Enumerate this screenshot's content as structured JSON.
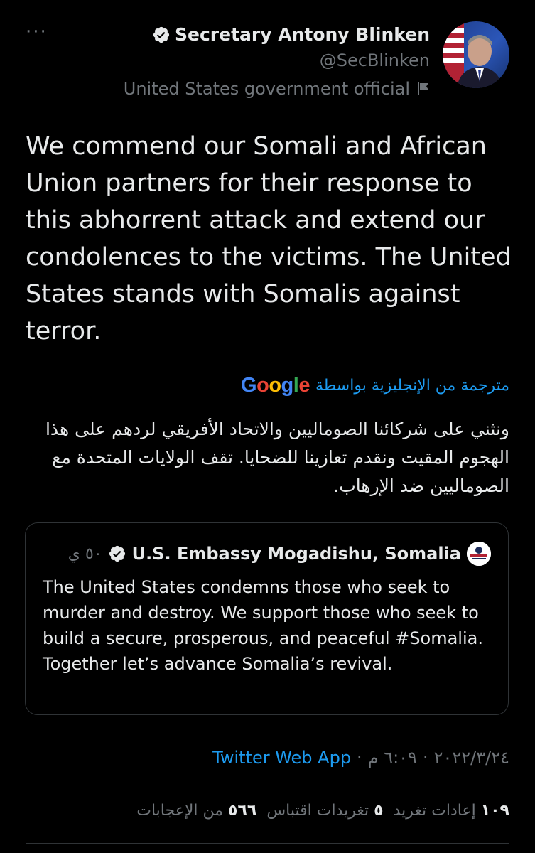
{
  "header": {
    "more_label": "···",
    "display_name": "Secretary Antony Blinken",
    "handle": "@SecBlinken",
    "account_label": "United States government official"
  },
  "tweet": {
    "text": "We commend our Somali and African Union partners for their response to this abhorrent attack and extend our condolences to the victims. The United States stands with Somalis against terror.",
    "translated_by": "مترجمة من الإنجليزية بواسطة",
    "translator": "Google",
    "translation": "ونثني على شركائنا الصوماليين والاتحاد الأفريقي لردهم على هذا الهجوم المقيت ونقدم تعازينا للضحايا. تقف الولايات المتحدة مع الصوماليين ضد الإرهاب."
  },
  "quote": {
    "name": "U.S. Embassy Mogadishu, Somalia",
    "time": "٥٠ ي",
    "text": "The United States  condemns those who seek to murder and destroy. We support those who seek to build a secure, prosperous, and peaceful #Somalia. Together let’s advance Somalia’s revival."
  },
  "meta": {
    "time": "٦:٠٩ م",
    "date": "٢٠٢٢/٣/٢٤",
    "source": "Twitter Web App",
    "sep": "·"
  },
  "stats": {
    "retweets_count": "١٠٩",
    "retweets_label": "إعادات تغريد",
    "quotes_count": "٥",
    "quotes_label": "تغريدات اقتباس",
    "likes_count": "٥٦٦",
    "likes_label": "من الإعجابات"
  },
  "colors": {
    "accent": "#1d9bf0",
    "muted": "#71767b",
    "border": "#2f3336",
    "background": "#000000"
  },
  "icons": [
    "more-icon",
    "verified-badge-icon",
    "flag-icon"
  ]
}
